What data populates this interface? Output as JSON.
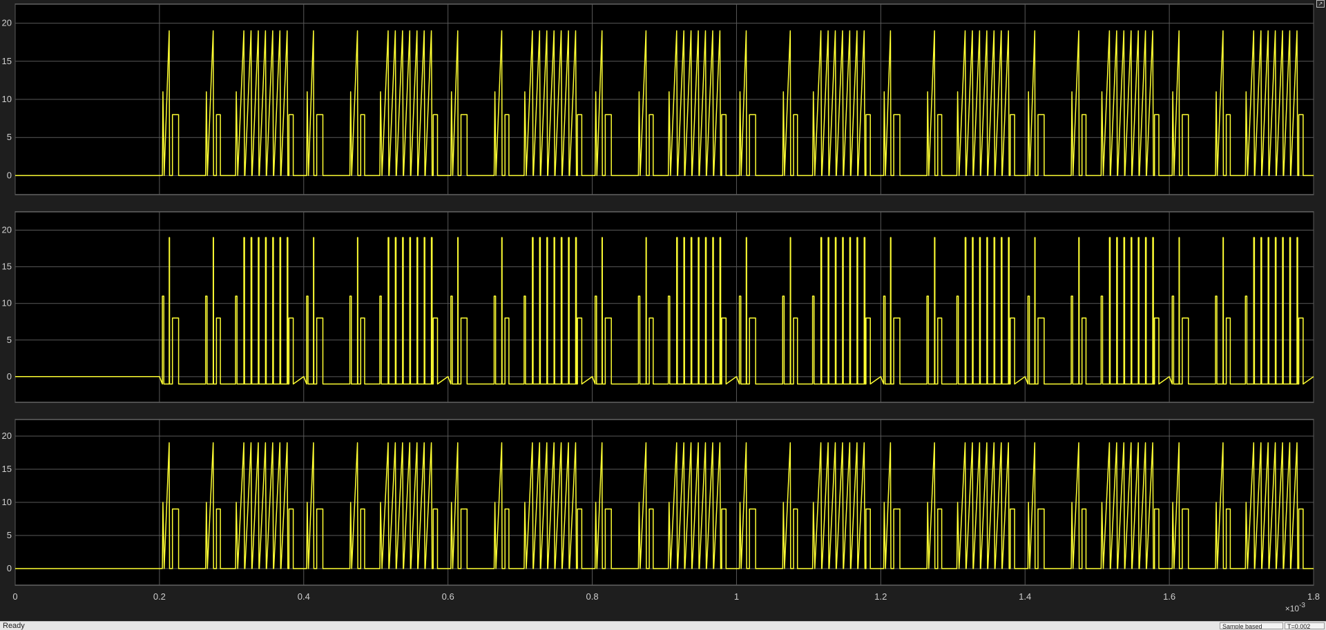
{
  "window": {
    "status_text": "Ready",
    "sample_label": "Sample based",
    "time_label": "T=0.002",
    "undock_glyph": "↗"
  },
  "colors": {
    "background": "#1e1e1e",
    "plot_background": "#000000",
    "grid": "#5a5a5a",
    "axes_text": "#cfcfcf",
    "trace": "#ffff33"
  },
  "chart_data": [
    {
      "type": "line",
      "title": "",
      "xlabel": "",
      "ylabel": "",
      "xlim": [
        0,
        1.8
      ],
      "ylim": [
        -2.5,
        22.5
      ],
      "x_ticks": [
        "0",
        "0.2",
        "0.4",
        "0.6",
        "0.8",
        "1",
        "1.2",
        "1.4",
        "1.6",
        "1.8"
      ],
      "y_ticks": [
        "0",
        "5",
        "10",
        "15",
        "20"
      ],
      "x_exponent": "-3",
      "grid": true,
      "legend": "none",
      "series": [
        {
          "x_unit_scale": 0.001,
          "period": 0.2,
          "start": 0.2,
          "low": 0,
          "high": 19,
          "mid": 11,
          "step": 8,
          "burst_count": 7,
          "ramp": true
        }
      ]
    },
    {
      "type": "line",
      "title": "",
      "xlabel": "",
      "ylabel": "",
      "xlim": [
        0,
        1.8
      ],
      "ylim": [
        -3.5,
        22.5
      ],
      "x_ticks": [
        "0",
        "0.2",
        "0.4",
        "0.6",
        "0.8",
        "1",
        "1.2",
        "1.4",
        "1.6",
        "1.8"
      ],
      "y_ticks": [
        "0",
        "5",
        "10",
        "15",
        "20"
      ],
      "x_exponent": "-3",
      "grid": true,
      "legend": "none",
      "series": [
        {
          "x_unit_scale": 0.001,
          "period": 0.2,
          "start": 0.2,
          "low": -1,
          "high": 19,
          "mid": 11,
          "step": 8,
          "burst_count": 7,
          "ramp": false
        }
      ]
    },
    {
      "type": "line",
      "title": "",
      "xlabel": "",
      "ylabel": "",
      "xlim": [
        0,
        1.8
      ],
      "ylim": [
        -2.5,
        22.5
      ],
      "x_ticks": [
        "0",
        "0.2",
        "0.4",
        "0.6",
        "0.8",
        "1",
        "1.2",
        "1.4",
        "1.6",
        "1.8"
      ],
      "y_ticks": [
        "0",
        "5",
        "10",
        "15",
        "20"
      ],
      "x_exponent": "-3",
      "grid": true,
      "legend": "none",
      "series": [
        {
          "x_unit_scale": 0.001,
          "period": 0.2,
          "start": 0.2,
          "low": 0,
          "high": 19,
          "mid": 10,
          "step": 9,
          "burst_count": 7,
          "ramp": true
        }
      ]
    }
  ]
}
